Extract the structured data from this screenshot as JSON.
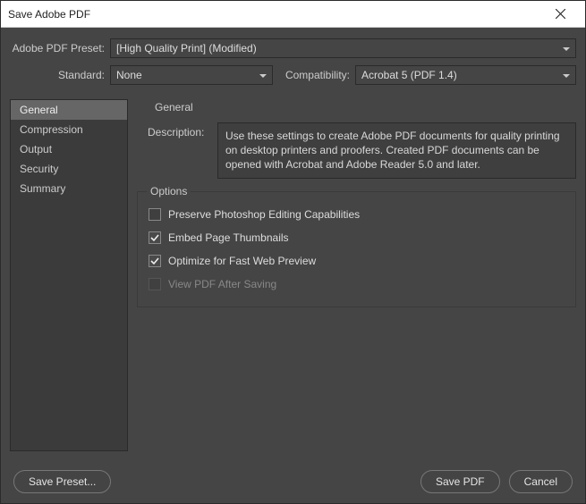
{
  "window": {
    "title": "Save Adobe PDF"
  },
  "controls": {
    "preset_label": "Adobe PDF Preset:",
    "preset_value": "[High Quality Print] (Modified)",
    "standard_label": "Standard:",
    "standard_value": "None",
    "compat_label": "Compatibility:",
    "compat_value": "Acrobat 5 (PDF 1.4)"
  },
  "sidebar": {
    "items": [
      {
        "label": "General",
        "active": true
      },
      {
        "label": "Compression",
        "active": false
      },
      {
        "label": "Output",
        "active": false
      },
      {
        "label": "Security",
        "active": false
      },
      {
        "label": "Summary",
        "active": false
      }
    ]
  },
  "panel": {
    "heading": "General",
    "description_label": "Description:",
    "description_text": "Use these settings to create Adobe PDF documents for quality printing on desktop printers and proofers.  Created PDF documents can be opened with Acrobat and Adobe Reader 5.0 and later.",
    "options_legend": "Options",
    "options": [
      {
        "label": "Preserve Photoshop Editing Capabilities",
        "checked": false,
        "disabled": false
      },
      {
        "label": "Embed Page Thumbnails",
        "checked": true,
        "disabled": false
      },
      {
        "label": "Optimize for Fast Web Preview",
        "checked": true,
        "disabled": false
      },
      {
        "label": "View PDF After Saving",
        "checked": false,
        "disabled": true
      }
    ]
  },
  "footer": {
    "save_preset": "Save Preset...",
    "save_pdf": "Save PDF",
    "cancel": "Cancel"
  }
}
